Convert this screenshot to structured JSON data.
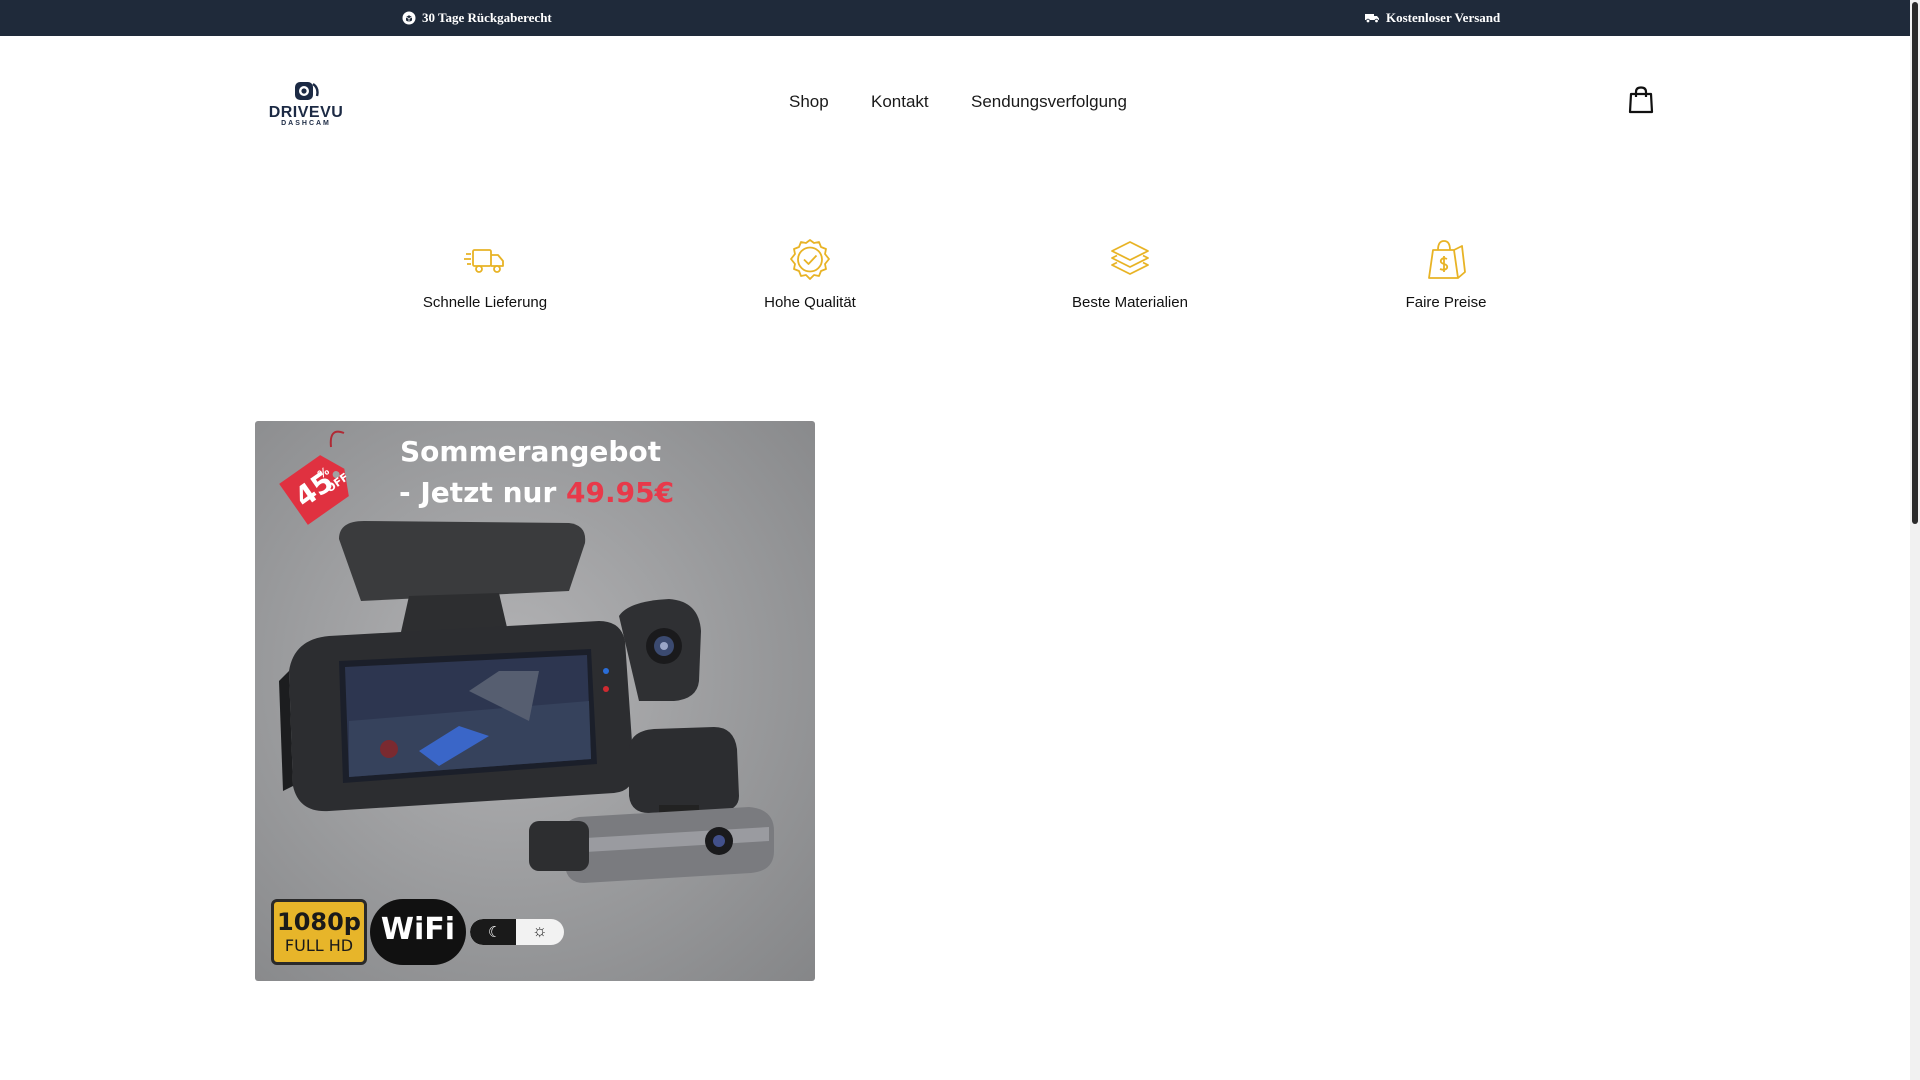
{
  "topbar": {
    "returns_text": "30 Tage Rückgaberecht",
    "returns_icon": "return-box-icon",
    "shipping_text": "Kostenloser Versand",
    "shipping_icon": "truck-icon",
    "background": "#1f2a3a"
  },
  "header": {
    "logo": {
      "name": "DRIVEVU",
      "sub": "DASHCAM"
    },
    "nav": [
      "Shop",
      "Kontakt",
      "Sendungsverfolgung"
    ],
    "cart_icon": "shopping-bag-icon"
  },
  "features": [
    {
      "icon": "fast-delivery-truck-icon",
      "label": "Schnelle Lieferung"
    },
    {
      "icon": "quality-badge-check-icon",
      "label": "Hohe Qualität"
    },
    {
      "icon": "layers-icon",
      "label": "Beste Materialien"
    },
    {
      "icon": "price-tag-dollar-icon",
      "label": "Faire Preise"
    }
  ],
  "accent_color": "#e8b325",
  "product_image": {
    "headline_1": "Sommerangebot",
    "headline_2_prefix": "- Jetzt nur ",
    "headline_2_price": "49.95€",
    "discount_badge": {
      "percent": "45",
      "symbol": "%",
      "off": "OFF"
    },
    "badge_resolution": "1080p",
    "badge_resolution_sub": "FULL HD",
    "badge_wifi": "WiFi",
    "badge_day_night_icons": [
      "moon-icon",
      "sun-icon"
    ]
  }
}
